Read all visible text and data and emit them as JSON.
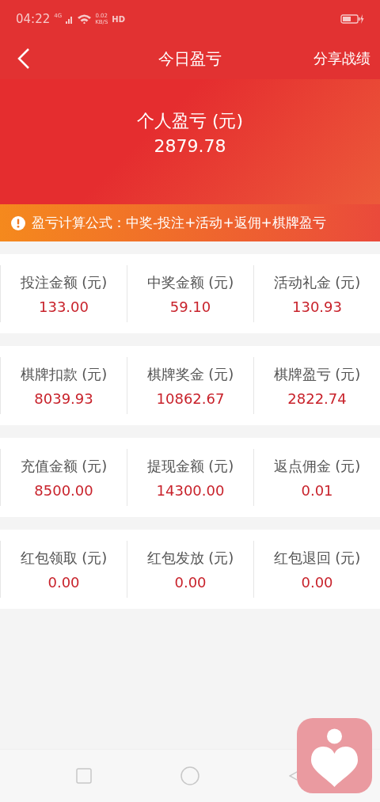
{
  "status_bar": {
    "time": "04:22",
    "network": "4G",
    "speed": "0.02",
    "speed_unit": "KB/S",
    "hd": "HD"
  },
  "header": {
    "title": "今日盈亏",
    "action": "分享战绩"
  },
  "summary": {
    "label": "个人盈亏 (元)",
    "value": "2879.78"
  },
  "notice": {
    "text": "盈亏计算公式：中奖-投注+活动+返佣+棋牌盈亏"
  },
  "stat_groups": [
    {
      "items": [
        {
          "label": "投注金额 (元)",
          "value": "133.00"
        },
        {
          "label": "中奖金额 (元)",
          "value": "59.10"
        },
        {
          "label": "活动礼金 (元)",
          "value": "130.93"
        }
      ]
    },
    {
      "items": [
        {
          "label": "棋牌扣款 (元)",
          "value": "8039.93"
        },
        {
          "label": "棋牌奖金 (元)",
          "value": "10862.67"
        },
        {
          "label": "棋牌盈亏 (元)",
          "value": "2822.74"
        }
      ]
    },
    {
      "items": [
        {
          "label": "充值金额 (元)",
          "value": "8500.00"
        },
        {
          "label": "提现金额 (元)",
          "value": "14300.00"
        },
        {
          "label": "返点佣金 (元)",
          "value": "0.01"
        }
      ]
    },
    {
      "items": [
        {
          "label": "红包领取 (元)",
          "value": "0.00"
        },
        {
          "label": "红包发放 (元)",
          "value": "0.00"
        },
        {
          "label": "红包退回 (元)",
          "value": "0.00"
        }
      ]
    }
  ]
}
